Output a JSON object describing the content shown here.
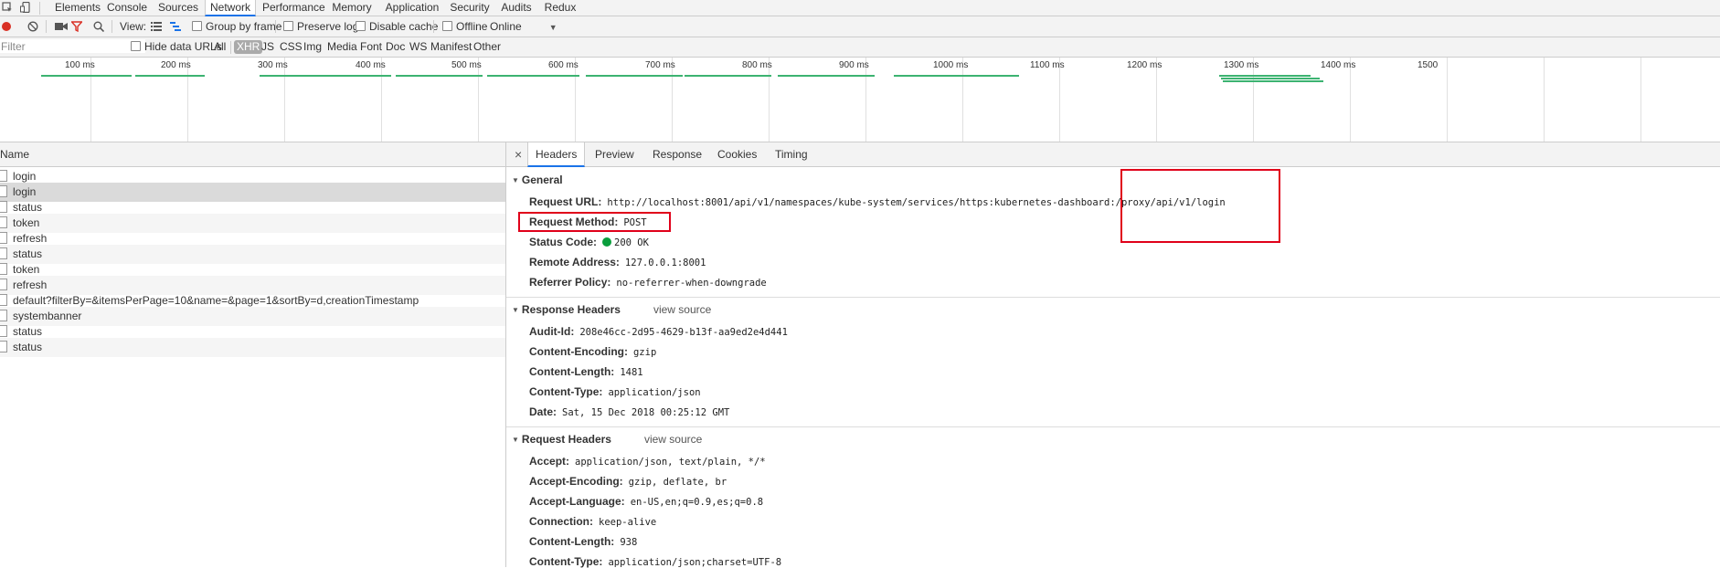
{
  "tabbar": {
    "tabs": [
      "Elements",
      "Console",
      "Sources",
      "Network",
      "Performance",
      "Memory",
      "Application",
      "Security",
      "Audits",
      "Redux"
    ],
    "active": "Network"
  },
  "toolbar": {
    "view_label": "View:",
    "group_by_frame": "Group by frame",
    "preserve_log": "Preserve log",
    "disable_cache": "Disable cache",
    "offline": "Offline",
    "throttle": "Online"
  },
  "filterbar": {
    "placeholder": "Filter",
    "hide_data_urls": "Hide data URLs",
    "types": [
      "All",
      "XHR",
      "JS",
      "CSS",
      "Img",
      "Media",
      "Font",
      "Doc",
      "WS",
      "Manifest",
      "Other"
    ],
    "selected_type": "XHR"
  },
  "timeline": {
    "ticks": [
      "100 ms",
      "200 ms",
      "300 ms",
      "400 ms",
      "500 ms",
      "600 ms",
      "700 ms",
      "800 ms",
      "900 ms",
      "1000 ms",
      "1100 ms",
      "1200 ms",
      "1300 ms",
      "1400 ms",
      "1500"
    ]
  },
  "requests": {
    "header": "Name",
    "selected_index": 1,
    "rows": [
      "login",
      "login",
      "status",
      "token",
      "refresh",
      "status",
      "token",
      "refresh",
      "default?filterBy=&itemsPerPage=10&name=&page=1&sortBy=d,creationTimestamp",
      "systembanner",
      "status",
      "status"
    ]
  },
  "detail": {
    "close": "×",
    "tabs": [
      "Headers",
      "Preview",
      "Response",
      "Cookies",
      "Timing"
    ],
    "active_tab": "Headers",
    "general": {
      "title": "General",
      "items": [
        {
          "k": "Request URL:",
          "v": "http://localhost:8001/api/v1/namespaces/kube-system/services/https:kubernetes-dashboard:/proxy/api/v1/login"
        },
        {
          "k": "Request Method:",
          "v": "POST"
        },
        {
          "k": "Status Code:",
          "v": "200 OK"
        },
        {
          "k": "Remote Address:",
          "v": "127.0.0.1:8001"
        },
        {
          "k": "Referrer Policy:",
          "v": "no-referrer-when-downgrade"
        }
      ]
    },
    "response_headers": {
      "title": "Response Headers",
      "view_source": "view source",
      "items": [
        {
          "k": "Audit-Id:",
          "v": "208e46cc-2d95-4629-b13f-aa9ed2e4d441"
        },
        {
          "k": "Content-Encoding:",
          "v": "gzip"
        },
        {
          "k": "Content-Length:",
          "v": "1481"
        },
        {
          "k": "Content-Type:",
          "v": "application/json"
        },
        {
          "k": "Date:",
          "v": "Sat, 15 Dec 2018 00:25:12 GMT"
        }
      ]
    },
    "request_headers": {
      "title": "Request Headers",
      "view_source": "view source",
      "items": [
        {
          "k": "Accept:",
          "v": "application/json, text/plain, */*"
        },
        {
          "k": "Accept-Encoding:",
          "v": "gzip, deflate, br"
        },
        {
          "k": "Accept-Language:",
          "v": "en-US,en;q=0.9,es;q=0.8"
        },
        {
          "k": "Connection:",
          "v": "keep-alive"
        },
        {
          "k": "Content-Length:",
          "v": "938"
        },
        {
          "k": "Content-Type:",
          "v": "application/json;charset=UTF-8"
        }
      ]
    }
  },
  "colors": {
    "accent": "#1a73e8",
    "highlight_box": "#e0001a",
    "status_ok": "#0a9e3c",
    "bar": "#3cb371"
  }
}
